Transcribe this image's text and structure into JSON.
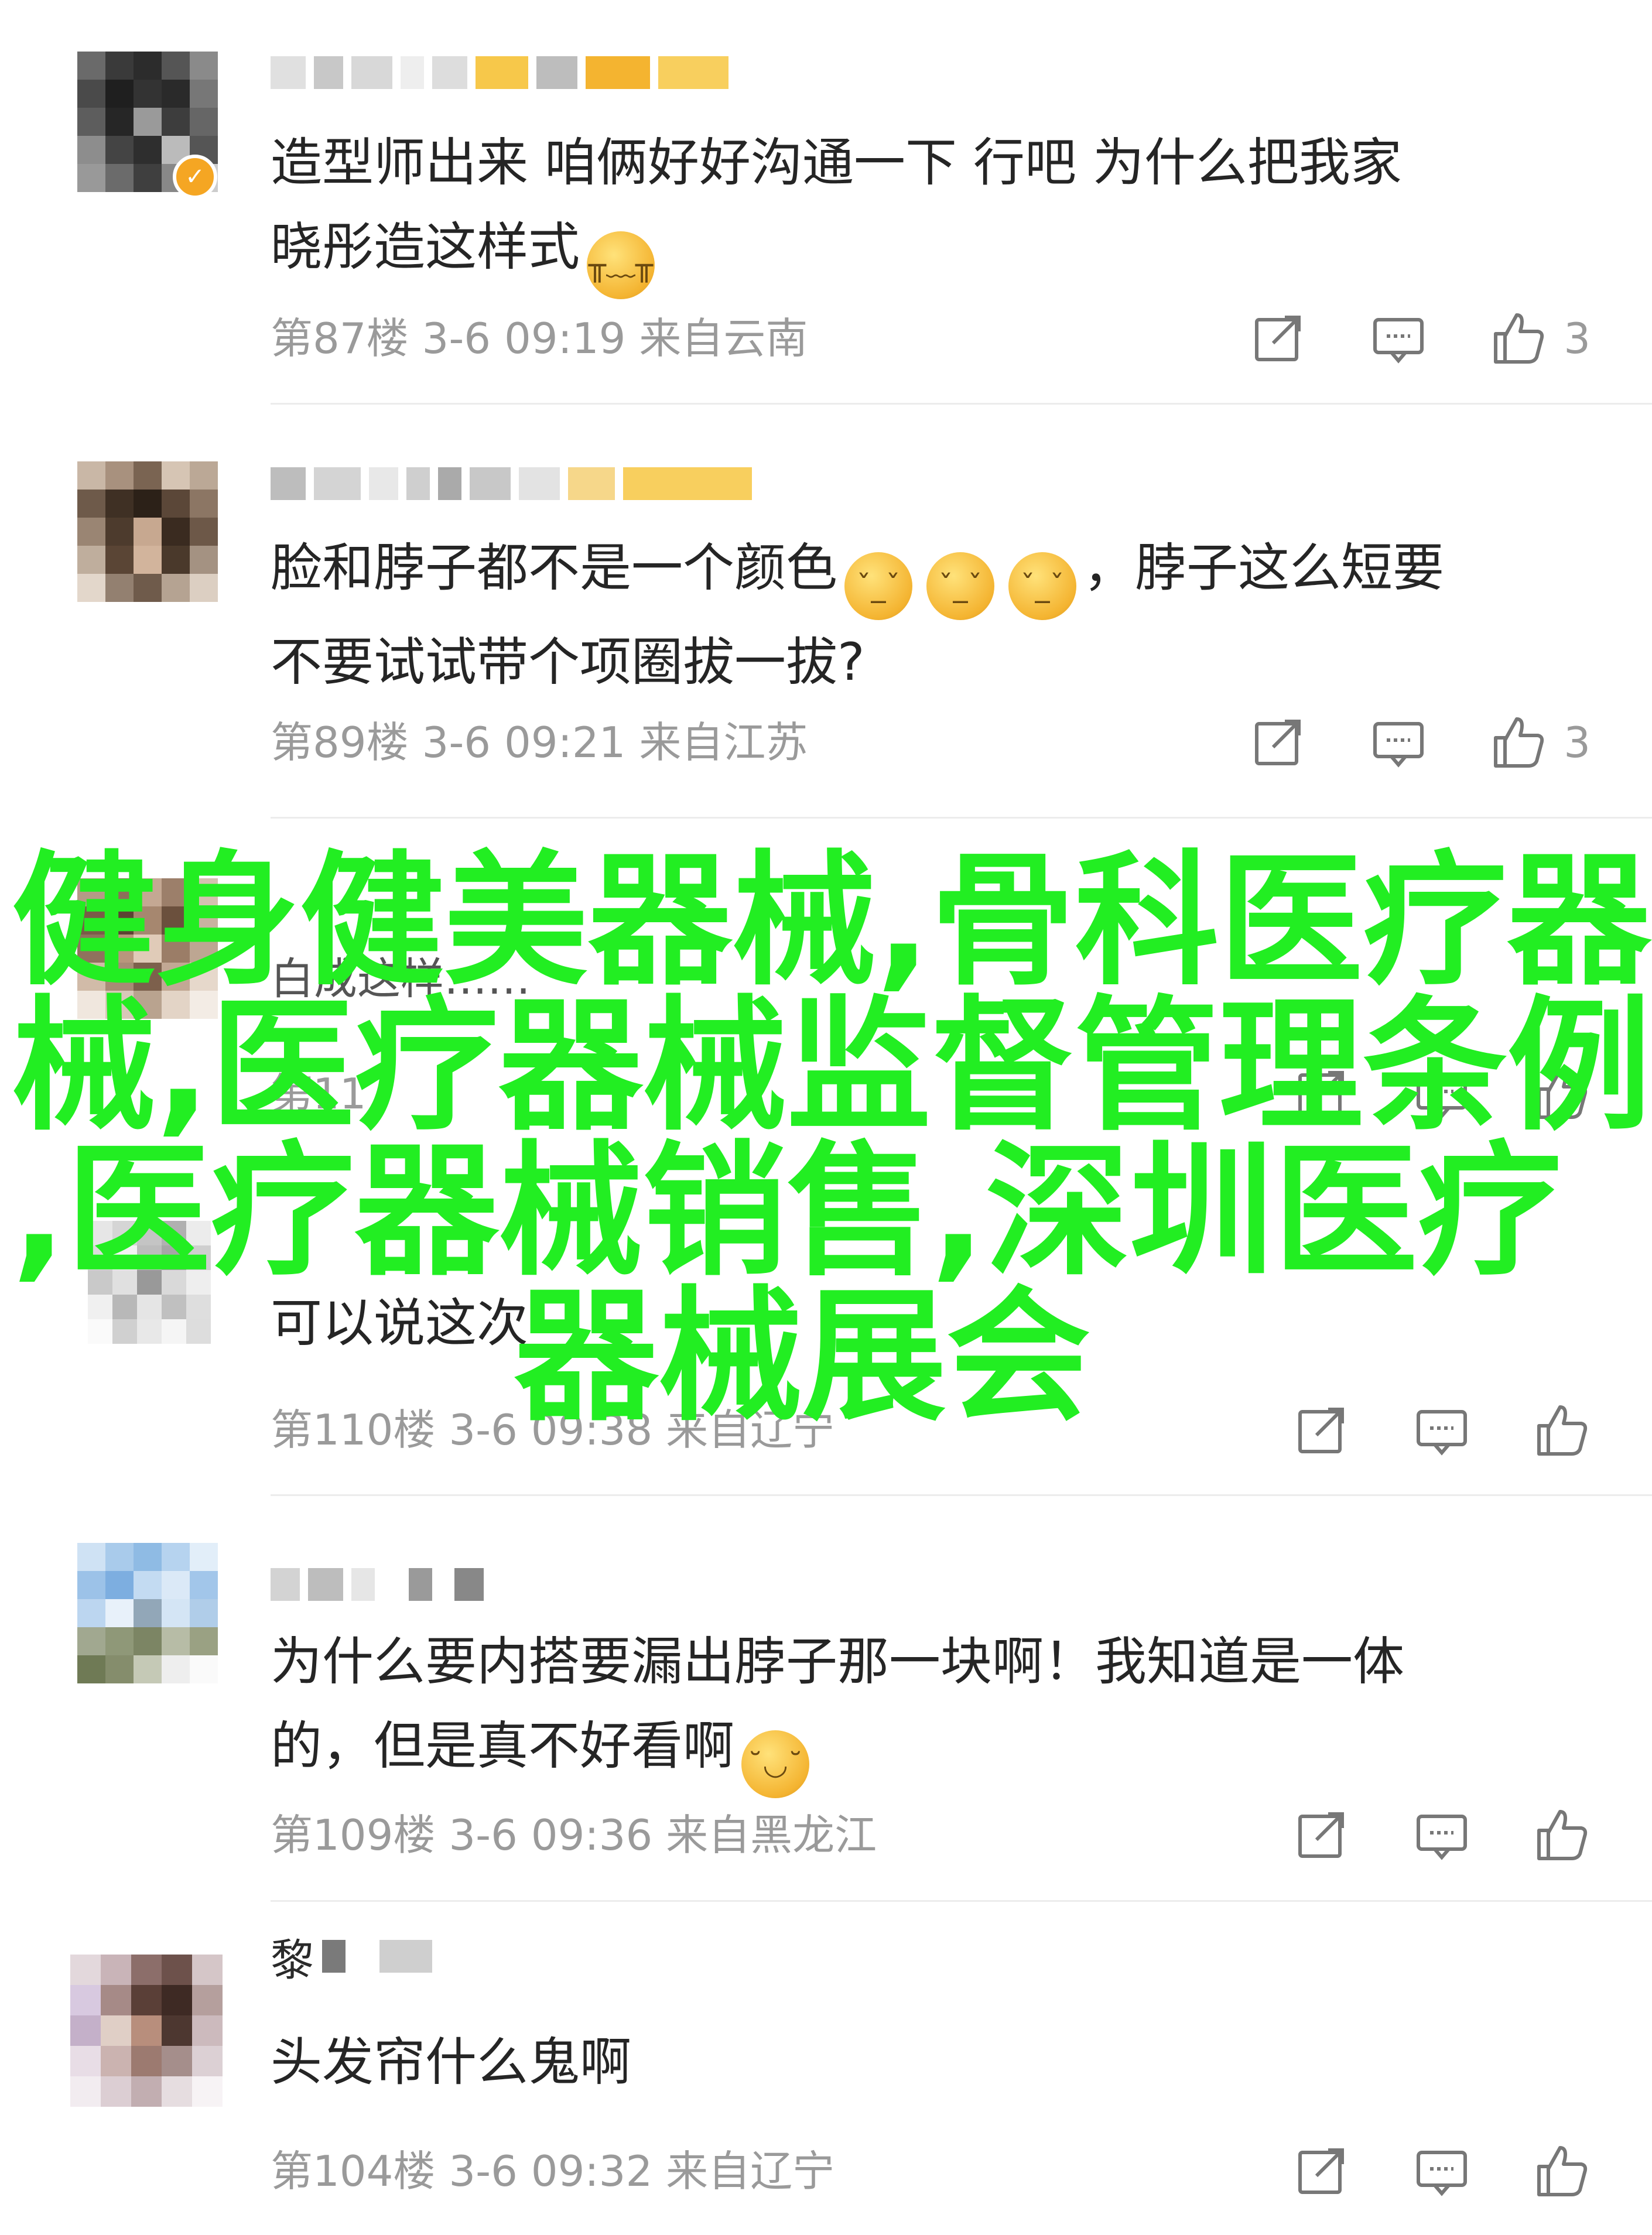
{
  "comments": [
    {
      "text_lines": [
        "造型师出来 咱俩好好沟通一下 行吧 为什么把我家",
        "晓彤造这样式"
      ],
      "emoji_after": "😭",
      "meta": "第87楼 3-6 09:19 来自云南",
      "likes": "3",
      "verified": true
    },
    {
      "text_lines_html": "脸和脖子都不是一个颜色",
      "after_emoji": "，脖子这么短要",
      "line2": "不要试试带个项圈拔一拔?",
      "meta": "第89楼 3-6 09:21 来自江苏",
      "likes": "3"
    },
    {
      "partial_text": "白成这样……",
      "meta_partial": "第11"
    },
    {
      "partial_text": "可以说这次",
      "meta": "第110楼 3-6 09:38 来自辽宁",
      "likes": ""
    },
    {
      "text_lines": [
        "为什么要内搭要漏出脖子那一块啊！我知道是一体",
        "的，但是真不好看啊"
      ],
      "meta": "第109楼 3-6 09:36 来自黑龙江",
      "likes": ""
    },
    {
      "name_char": "黎",
      "text_lines": [
        "头发帘什么鬼啊"
      ],
      "meta": "第104楼 3-6 09:32 来自辽宁",
      "likes": ""
    }
  ],
  "overlay": {
    "lines": [
      "健身健美器械,骨科医疗器",
      "械,医疗器械监督管理条例",
      ",医疗器械销售,深圳医疗",
      "器械展会"
    ],
    "color": "#22ee22"
  },
  "icons": [
    "share-icon",
    "comment-icon",
    "thumbs-up-icon",
    "verified-icon"
  ]
}
